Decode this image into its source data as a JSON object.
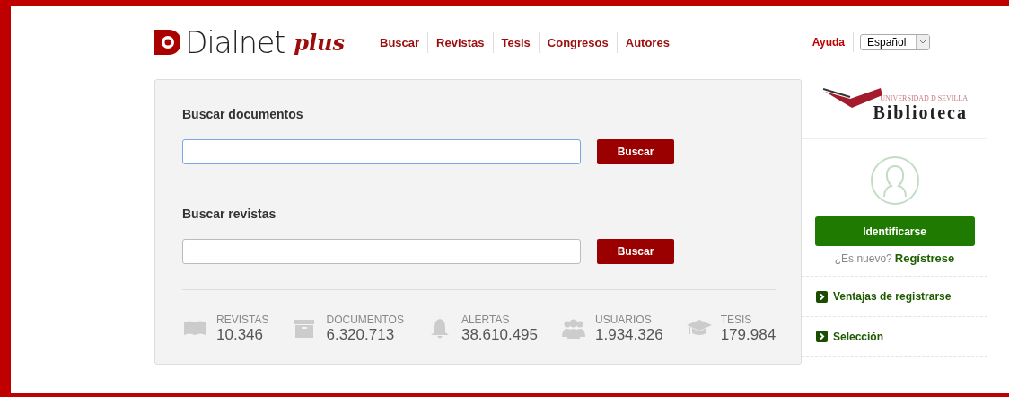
{
  "header": {
    "logo_text": "Dialnet",
    "logo_suffix": "plus",
    "nav": [
      "Buscar",
      "Revistas",
      "Tesis",
      "Congresos",
      "Autores"
    ],
    "help": "Ayuda",
    "language": "Español"
  },
  "search": [
    {
      "title": "Buscar documentos",
      "button": "Buscar",
      "focused": true
    },
    {
      "title": "Buscar revistas",
      "button": "Buscar",
      "focused": false
    }
  ],
  "stats": [
    {
      "kind": "book",
      "label": "REVISTAS",
      "value": "10.346"
    },
    {
      "kind": "box",
      "label": "DOCUMENTOS",
      "value": "6.320.713"
    },
    {
      "kind": "bell",
      "label": "ALERTAS",
      "value": "38.610.495"
    },
    {
      "kind": "users",
      "label": "USUARIOS",
      "value": "1.934.326"
    },
    {
      "kind": "cap",
      "label": "TESIS",
      "value": "179.984"
    }
  ],
  "sidebar": {
    "library_caption": "UNIVERSIDAD D SEVILLA",
    "library_name": "Biblioteca",
    "login_button": "Identificarse",
    "new_prompt": "¿Es nuevo?",
    "register_link": "Regístrese",
    "links": [
      "Ventajas de registrarse",
      "Selección"
    ]
  }
}
